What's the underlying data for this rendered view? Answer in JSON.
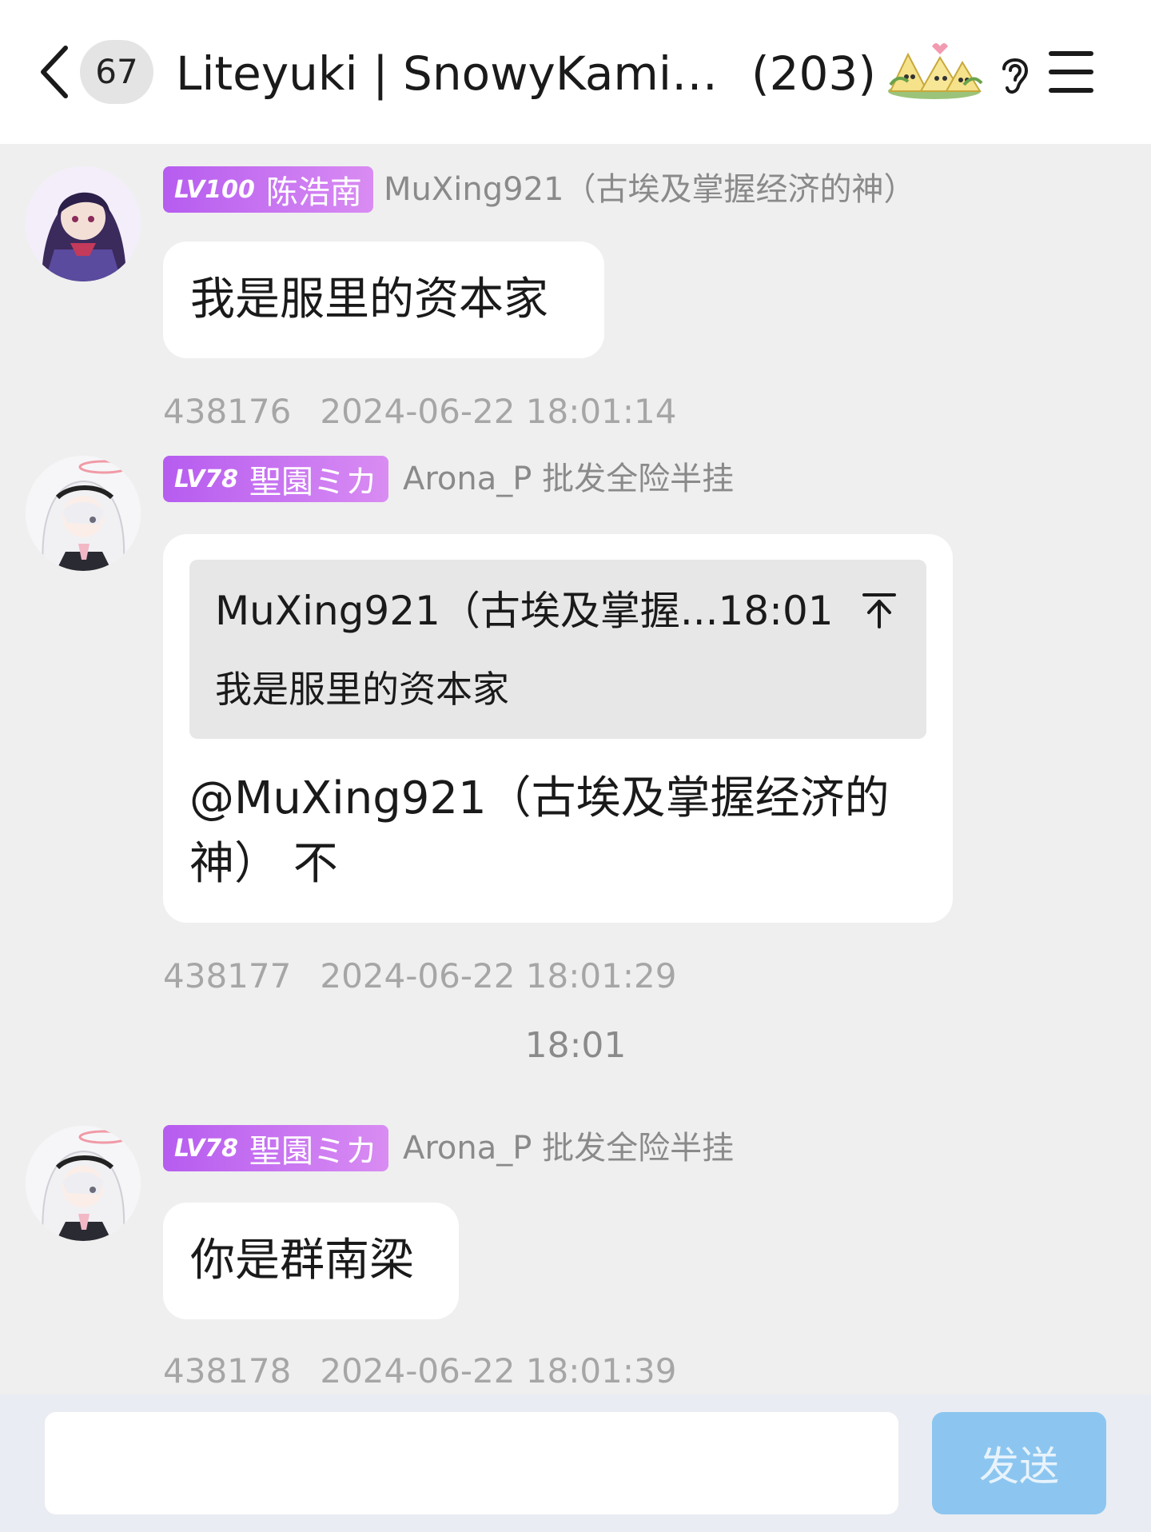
{
  "header": {
    "unread_count": "67",
    "title": "Liteyuki | SnowyKami |...",
    "member_count": "(203)"
  },
  "messages": [
    {
      "level": "LV100",
      "title_badge": "陈浩南",
      "sender": "MuXing921（古埃及掌握经济的神）",
      "text": "我是服里的资本家",
      "id": "438176",
      "time": "2024-06-22 18:01:14"
    },
    {
      "level": "LV78",
      "title_badge": "聖園ミカ",
      "sender": "Arona_P 批发全险半挂",
      "quote": {
        "head": "MuXing921（古埃及掌握...18:01",
        "body": "我是服里的资本家"
      },
      "text": "@MuXing921（古埃及掌握经济的神） 不",
      "id": "438177",
      "time": "2024-06-22 18:01:29"
    },
    {
      "level": "LV78",
      "title_badge": "聖園ミカ",
      "sender": "Arona_P 批发全险半挂",
      "text": "你是群南梁",
      "id": "438178",
      "time": "2024-06-22 18:01:39"
    }
  ],
  "time_divider": "18:01",
  "input": {
    "value": "",
    "send_label": "发送"
  },
  "colors": {
    "level_badge": "#b65cf0",
    "send_button": "#8cc6f0",
    "background": "#efefef"
  }
}
